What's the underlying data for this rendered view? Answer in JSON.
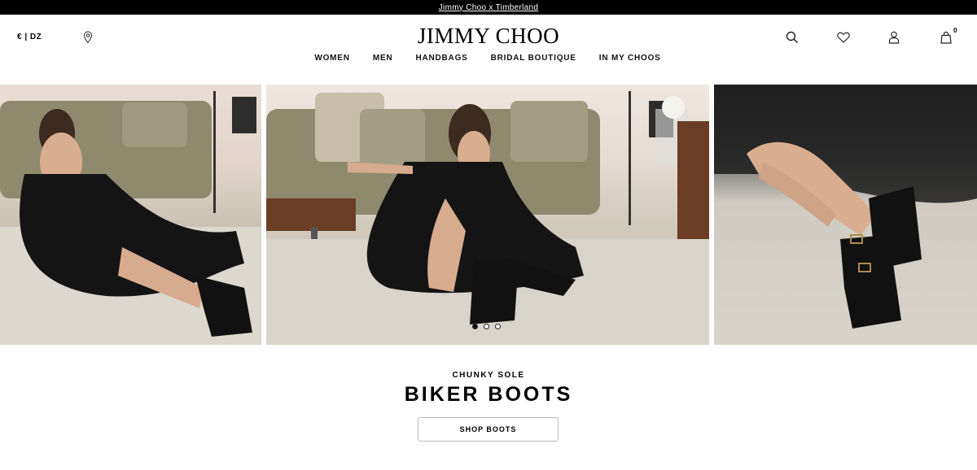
{
  "announcement": {
    "text": "Jimmy Choo x Timberland"
  },
  "header": {
    "locale": "€ | DZ",
    "logo": "JIMMY CHOO",
    "bag_count": "0",
    "icons": [
      "store-locator-icon",
      "search-icon",
      "heart-icon",
      "account-icon",
      "shopping-bag-icon"
    ]
  },
  "nav": {
    "items": [
      {
        "label": "WOMEN"
      },
      {
        "label": "MEN"
      },
      {
        "label": "HANDBAGS"
      },
      {
        "label": "BRIDAL BOUTIQUE"
      },
      {
        "label": "IN MY CHOOS"
      }
    ]
  },
  "hero": {
    "slides": [
      "slide-1",
      "slide-2",
      "slide-3"
    ],
    "active_slide": 1
  },
  "promo": {
    "kicker": "CHUNKY SOLE",
    "headline": "BIKER BOOTS",
    "cta": "SHOP BOOTS"
  },
  "colors": {
    "topbar": "#000000",
    "text": "#000000",
    "background": "#ffffff"
  }
}
